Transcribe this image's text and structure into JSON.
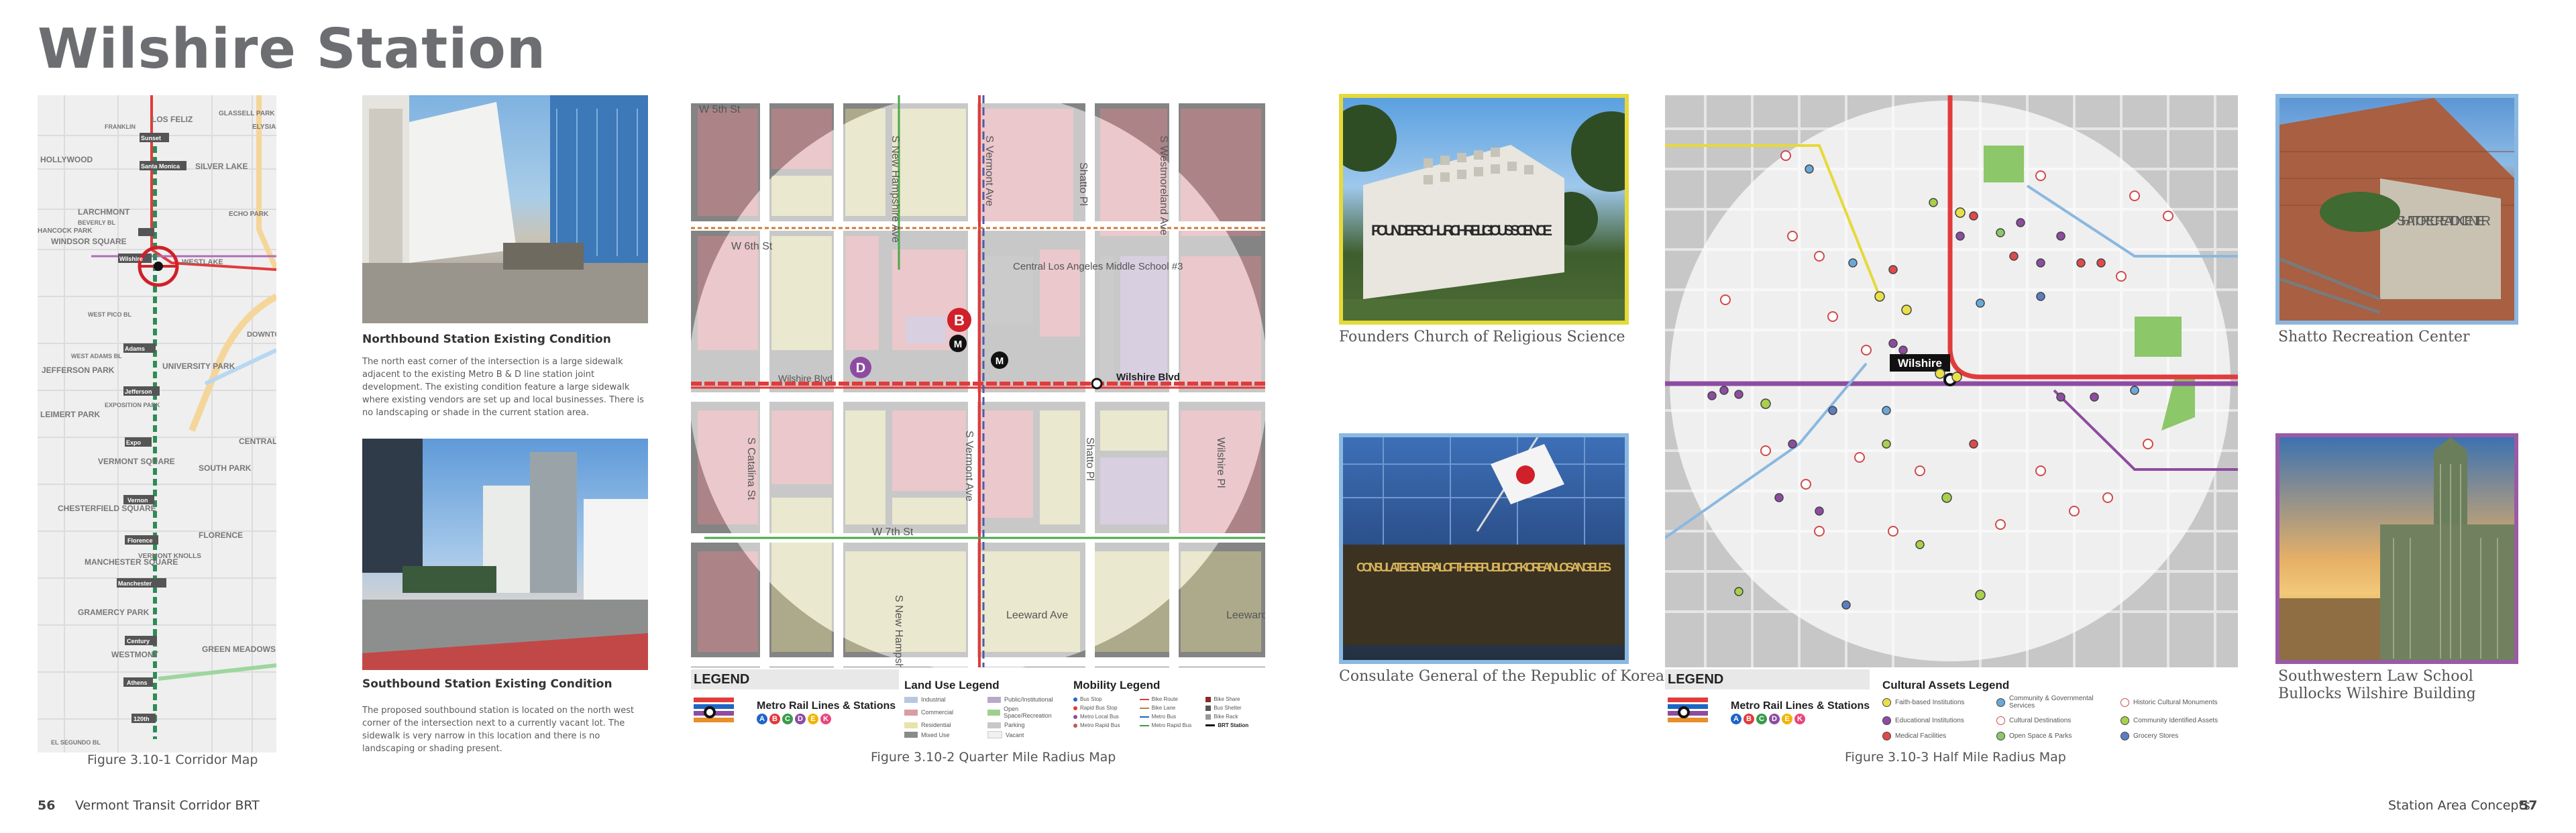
{
  "page": {
    "title": "Wilshire Station",
    "left_page_number": "56",
    "left_running_head": "Vermont Transit Corridor BRT",
    "right_running_head": "Station Area Concepts",
    "right_page_number": "57"
  },
  "corridor_map": {
    "caption": "Figure 3.10-1 Corridor Map",
    "labels": [
      "LOS FELIZ",
      "FRANKLIN",
      "HOLLYWOOD",
      "Sunset",
      "Santa Monica",
      "SILVER LAKE",
      "ECHO PARK",
      "LARCHMONT",
      "BEVERLY BL",
      "WINDSOR SQUARE",
      "HANCOCK PARK",
      "Wilshire",
      "WESTLAKE",
      "WEST PICO BL",
      "WEST ADAMS BL",
      "JEFFERSON PARK",
      "Adams",
      "Jefferson",
      "UNIVERSITY PARK",
      "Expo",
      "EXPOSITION PARK",
      "LEIMERT PARK",
      "Vernon",
      "VERMONT SQUARE",
      "SOUTH PARK",
      "CENTRAL-A",
      "CHESTERFIELD SQUARE",
      "Florence",
      "FLORENCE",
      "MANCHESTER SQUARE",
      "Manchester",
      "VERMONT KNOLLS",
      "GRAMERCY PARK",
      "Century",
      "WESTMONT",
      "Athens",
      "GREEN MEADOWS",
      "120th",
      "EL SEGUNDO BL",
      "DOWNTOWN",
      "ELYSIAN VALLEY",
      "GLASSELL PARK"
    ]
  },
  "photos_left": {
    "north_heading": "Northbound Station Existing Condition",
    "north_text": "The north east corner of the intersection is a large sidewalk adjacent to the existing Metro B & D line station joint development. The existing condition feature a large sidewalk where existing vendors are set up and local businesses. There is no landscaping or shade in the current station area.",
    "south_heading": "Southbound Station Existing Condition",
    "south_text": "The proposed southbound station is located on the north west corner of the intersection next to a currently vacant lot. The sidewalk is very narrow in this location and there is no landscaping or shading present."
  },
  "quarter_map": {
    "caption": "Figure 3.10-2 Quarter Mile Radius Map",
    "street_labels": [
      "W 5th St",
      "S New Hampshire Ave",
      "S Vermont Ave",
      "Shatto Pl",
      "S Westmoreland Ave",
      "W 6th St",
      "Central Los Angeles Middle School #3",
      "Wilshire Blvd",
      "Wilshire Blvd",
      "S Catalina St",
      "S Vermont Ave",
      "Shatto Pl",
      "Wilshire Pl",
      "W 7th St",
      "S New Hampshire",
      "Leeward Ave",
      "Leeward Ave"
    ],
    "legend_title": "LEGEND",
    "metro_title": "Metro Rail Lines & Stations",
    "metro_lines": [
      "A",
      "B",
      "C",
      "D",
      "E",
      "K"
    ],
    "land_use_title": "Land Use Legend",
    "land_use": [
      "Industrial",
      "Commercial",
      "Residential",
      "Mixed Use",
      "Public/Institutional",
      "Open Space/Recreation",
      "Parking",
      "Vacant"
    ],
    "mobility_title": "Mobility Legend",
    "mobility": [
      "Bus Stop",
      "Rapid Bus Stop",
      "Metro Local Bus",
      "Metro Rapid Bus",
      "Bike Route",
      "Bike Lane",
      "Metro Bus",
      "Metro Rapid Bus",
      "Bike Share",
      "Bus Shelter",
      "Bike Rack",
      "BRT Station"
    ],
    "map_labels": {
      "b": "B",
      "d": "D",
      "m": "M"
    }
  },
  "photos_right": {
    "founders_caption": "Founders Church of Religious Science",
    "founders_sign": "FOUNDER'S CHURCH RELIGIOUS SCIENCE",
    "consulate_caption": "Consulate General of the Republic of Korea",
    "consulate_sign": "CONSULATE GENERAL OF THE REPUBLIC OF KOREA IN LOS ANGELES",
    "shatto_caption": "Shatto Recreation Center",
    "shatto_sign": "SHATTO RECREATION CENTER",
    "swlaw_caption_1": "Southwestern Law School",
    "swlaw_caption_2": "Bullocks Wilshire Building"
  },
  "half_map": {
    "caption": "Figure 3.10-3 Half Mile Radius Map",
    "station_label": "Wilshire",
    "legend_title": "LEGEND",
    "metro_title": "Metro Rail Lines & Stations",
    "metro_lines": [
      "A",
      "B",
      "C",
      "D",
      "E",
      "K"
    ],
    "cultural_title": "Cultural Assets Legend",
    "cultural": [
      {
        "label": "Faith-based Institutions",
        "color": "#e8e04a"
      },
      {
        "label": "Educational Institutions",
        "color": "#8d4ca1"
      },
      {
        "label": "Medical Facilities",
        "color": "#e04a4a"
      },
      {
        "label": "Community & Governmental Services",
        "color": "#6aa8d8"
      },
      {
        "label": "Cultural Destinations",
        "color": "#ffffff"
      },
      {
        "label": "Open Space & Parks",
        "color": "#8cc76a"
      },
      {
        "label": "Historic Cultural Monuments",
        "color": "#ffffff"
      },
      {
        "label": "Community Identified Assets",
        "color": "#a8d04a"
      },
      {
        "label": "Grocery Stores",
        "color": "#5a7ec0"
      }
    ]
  },
  "colors": {
    "heading_gray": "#6d6e71",
    "metro_red": "#e23b3b",
    "metro_purple": "#8d4ca1",
    "founders_yellow": "#e6d93a",
    "consulate_blue": "#8ab8e0",
    "swlaw_purple": "#9b5aa6"
  }
}
